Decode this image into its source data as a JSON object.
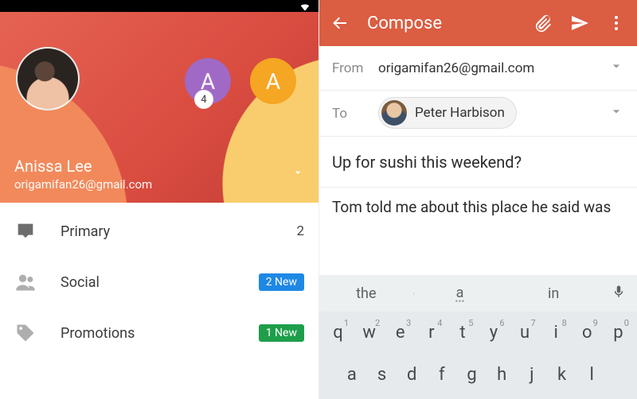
{
  "left": {
    "account": {
      "name": "Anissa Lee",
      "email": "origamifan26@gmail.com",
      "alt_avatars": [
        {
          "initial": "A",
          "color": "#a069c5"
        },
        {
          "initial": "A",
          "color": "#f5a623"
        }
      ],
      "alt_badge": "4"
    },
    "nav": [
      {
        "icon": "inbox-icon",
        "label": "Primary",
        "trailing_text": "2",
        "trailing_type": "count"
      },
      {
        "icon": "people-icon",
        "label": "Social",
        "trailing_text": "2 New",
        "trailing_type": "chip-blue"
      },
      {
        "icon": "tag-icon",
        "label": "Promotions",
        "trailing_text": "1 New",
        "trailing_type": "chip-green"
      }
    ]
  },
  "right": {
    "title": "Compose",
    "from_label": "From",
    "from_value": "origamifan26@gmail.com",
    "to_label": "To",
    "to_chip": "Peter Harbison",
    "subject": "Up for sushi this weekend?",
    "body": "Tom told me about this place he said was",
    "keyboard": {
      "suggestions": [
        "the",
        "a",
        "in"
      ],
      "row1": [
        {
          "k": "q",
          "n": "1"
        },
        {
          "k": "w",
          "n": "2"
        },
        {
          "k": "e",
          "n": "3"
        },
        {
          "k": "r",
          "n": "4"
        },
        {
          "k": "t",
          "n": "5"
        },
        {
          "k": "y",
          "n": "6"
        },
        {
          "k": "u",
          "n": "7"
        },
        {
          "k": "i",
          "n": "8"
        },
        {
          "k": "o",
          "n": "9"
        },
        {
          "k": "p",
          "n": "0"
        }
      ],
      "row2": [
        "a",
        "s",
        "d",
        "f",
        "g",
        "h",
        "j",
        "k",
        "l"
      ]
    }
  }
}
